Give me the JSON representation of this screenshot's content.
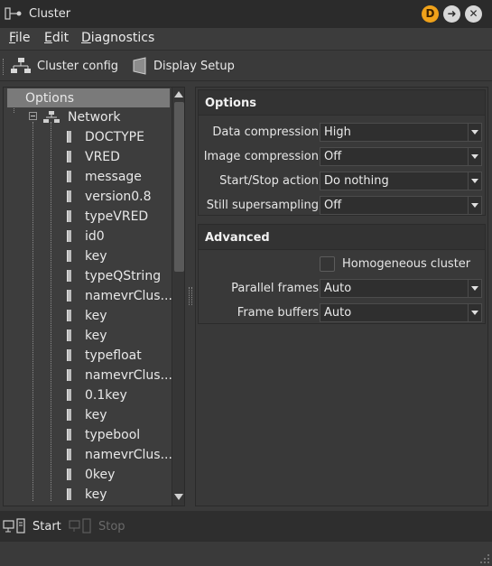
{
  "window": {
    "title": "Cluster"
  },
  "menu": {
    "file": "File",
    "edit": "Edit",
    "diagnostics": "Diagnostics"
  },
  "toolbar": {
    "cluster_config": "Cluster config",
    "display_setup": "Display Setup"
  },
  "tree": {
    "root": "Options",
    "network": "Network",
    "leaves": [
      "DOCTYPE",
      "VRED",
      "message",
      "version0.8",
      "typeVRED",
      "id0",
      "key",
      "typeQString",
      "namevrClus...",
      "key",
      "key",
      "typefloat",
      "namevrClus...",
      "0.1key",
      "key",
      "typebool",
      "namevrClus...",
      "0key",
      "key"
    ]
  },
  "options": {
    "header": "Options",
    "rows": [
      {
        "label": "Data compression",
        "value": "High"
      },
      {
        "label": "Image compression",
        "value": "Off"
      },
      {
        "label": "Start/Stop action",
        "value": "Do nothing"
      },
      {
        "label": "Still supersampling",
        "value": "Off"
      }
    ]
  },
  "advanced": {
    "header": "Advanced",
    "checkbox_label": "Homogeneous cluster",
    "checkbox_checked": false,
    "rows": [
      {
        "label": "Parallel frames",
        "value": "Auto"
      },
      {
        "label": "Frame buffers",
        "value": "Auto"
      }
    ]
  },
  "bottom": {
    "start": "Start",
    "stop": "Stop"
  },
  "colors": {
    "title_badge": "#f0a21a",
    "selection": "#7a7a7a",
    "background": "#3a3a3a"
  }
}
